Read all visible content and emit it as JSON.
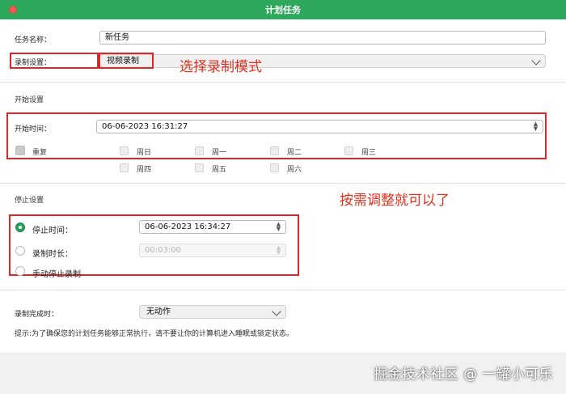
{
  "window": {
    "title": "计划任务"
  },
  "task": {
    "name_label": "任务名称：",
    "name_value": "新任务",
    "record_label": "录制设置：",
    "record_value": "视频录制",
    "record_annotation": "选择录制模式"
  },
  "start": {
    "section_title": "开始设置",
    "time_label": "开始时间：",
    "time_value": "06-06-2023 16:31:27",
    "repeat_label": "重复",
    "days": [
      "周日",
      "周一",
      "周二",
      "周三",
      "周四",
      "周五",
      "周六"
    ],
    "annotation": "按需调整就可以了"
  },
  "stop": {
    "section_title": "停止设置",
    "options": [
      {
        "label": "停止时间：",
        "value": "06-06-2023 16:34:27",
        "selected": true
      },
      {
        "label": "录制时长：",
        "value": "00:03:00",
        "selected": false
      },
      {
        "label": "手动停止录制",
        "selected": false
      }
    ]
  },
  "completion": {
    "label": "录制完成时：",
    "value": "无动作"
  },
  "hint": "提示:为了确保您的计划任务能够正常执行，请不要让你的计算机进入睡眠或锁定状态。",
  "watermark": "掘金技术社区 @ 一罐小可乐",
  "colors": {
    "titlebar": "#2ea85c",
    "annotation": "#e0321f",
    "radio_selected": "#28a45a"
  }
}
